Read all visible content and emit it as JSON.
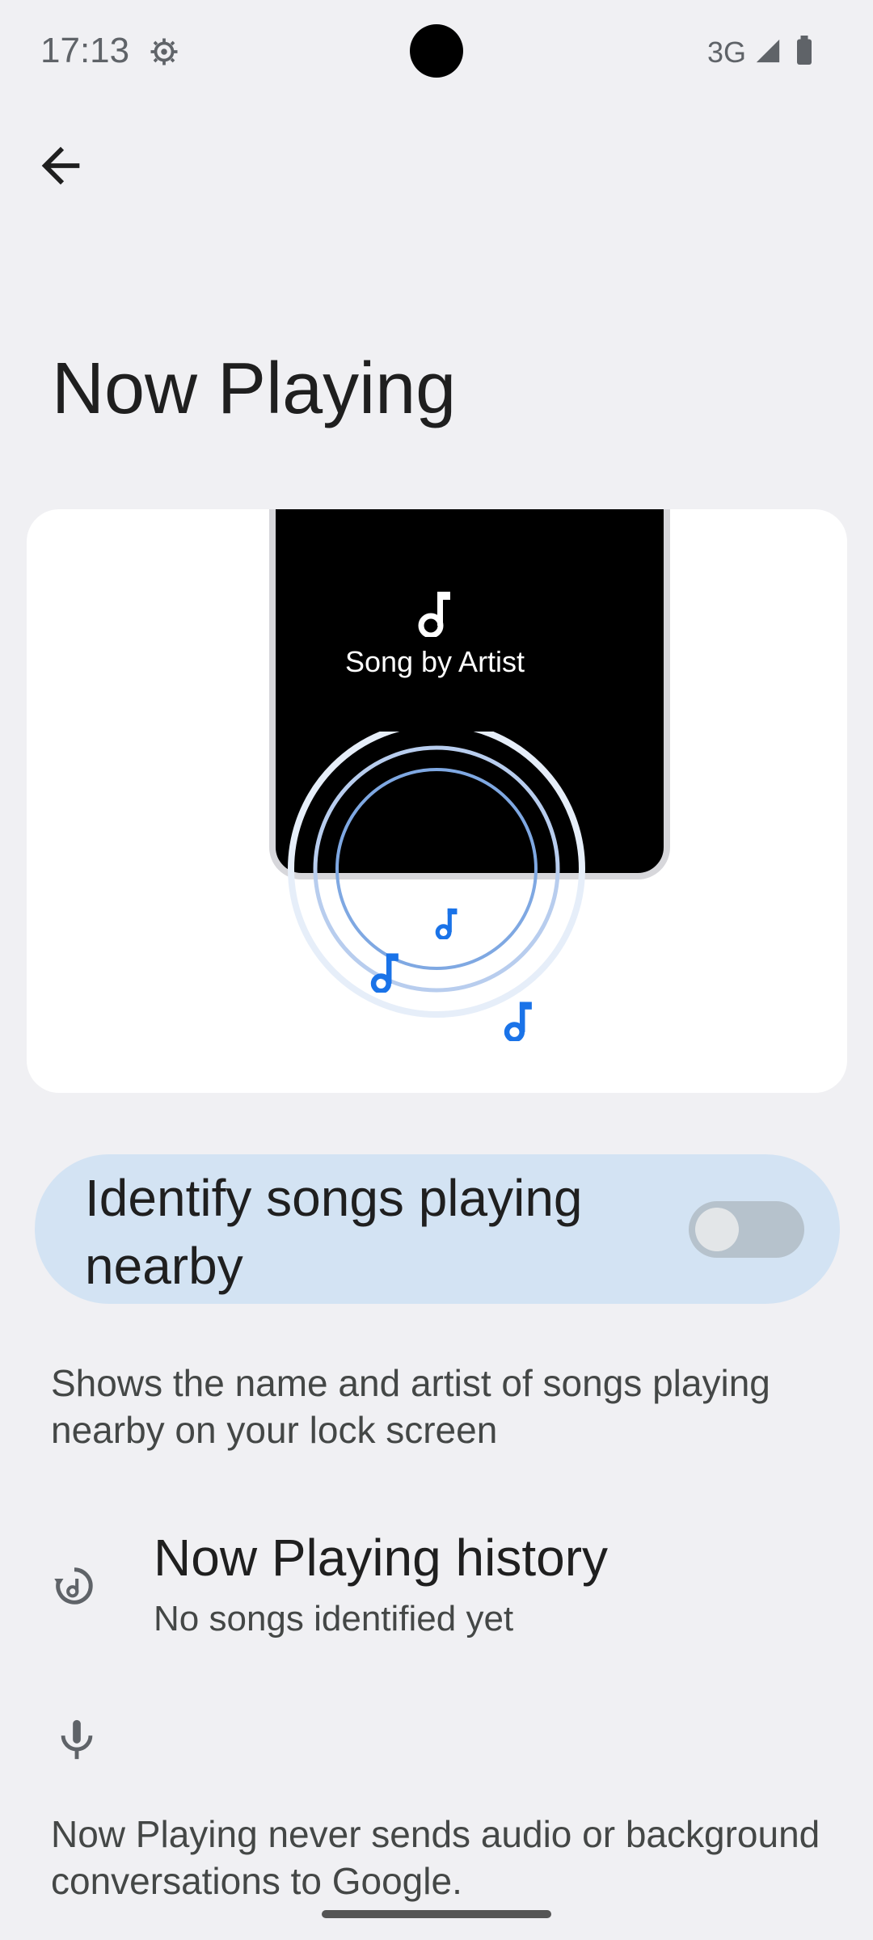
{
  "status_bar": {
    "time": "17:13",
    "network": "3G"
  },
  "page": {
    "title": "Now Playing"
  },
  "illustration": {
    "song_text": "Song by Artist"
  },
  "toggle": {
    "label": "Identify songs playing nearby",
    "enabled": false
  },
  "description": "Shows the name and artist of songs playing nearby on your lock screen",
  "history": {
    "title": "Now Playing history",
    "subtitle": "No songs identified yet"
  },
  "privacy": {
    "text": "Now Playing never sends audio or background conversations to Google."
  },
  "colors": {
    "accent": "#1a73e8",
    "toggle_bg": "#d3e3f3"
  }
}
